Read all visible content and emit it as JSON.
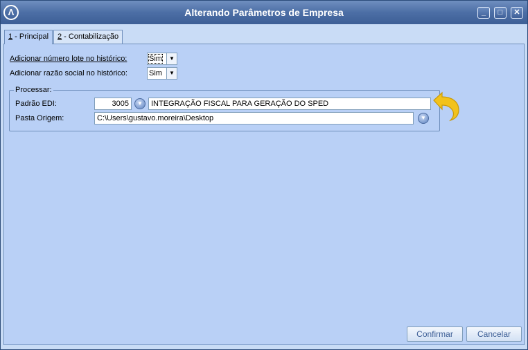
{
  "window": {
    "title": "Alterando Parâmetros de Empresa"
  },
  "tabs": [
    {
      "key": "1",
      "label": " - Principal",
      "active": true
    },
    {
      "key": "2",
      "label": " - Contabilização",
      "active": false
    }
  ],
  "form": {
    "lote_label": "Adicionar número lote no histórico:",
    "lote_value": "Sim",
    "razao_label": "Adicionar razão social no histórico:",
    "razao_value": "Sim"
  },
  "processar": {
    "title": "Processar:",
    "padrao_label": "Padrão EDI:",
    "padrao_code": "3005",
    "padrao_desc": "INTEGRAÇÃO FISCAL PARA GERAÇÃO DO SPED",
    "pasta_label": "Pasta Origem:",
    "pasta_value": "C:\\Users\\gustavo.moreira\\Desktop"
  },
  "buttons": {
    "confirm": "Confirmar",
    "cancel": "Cancelar"
  },
  "colors": {
    "titlebar": "#4c6ea5",
    "panel": "#b9d0f6",
    "accent_arrow": "#f2c21b"
  }
}
